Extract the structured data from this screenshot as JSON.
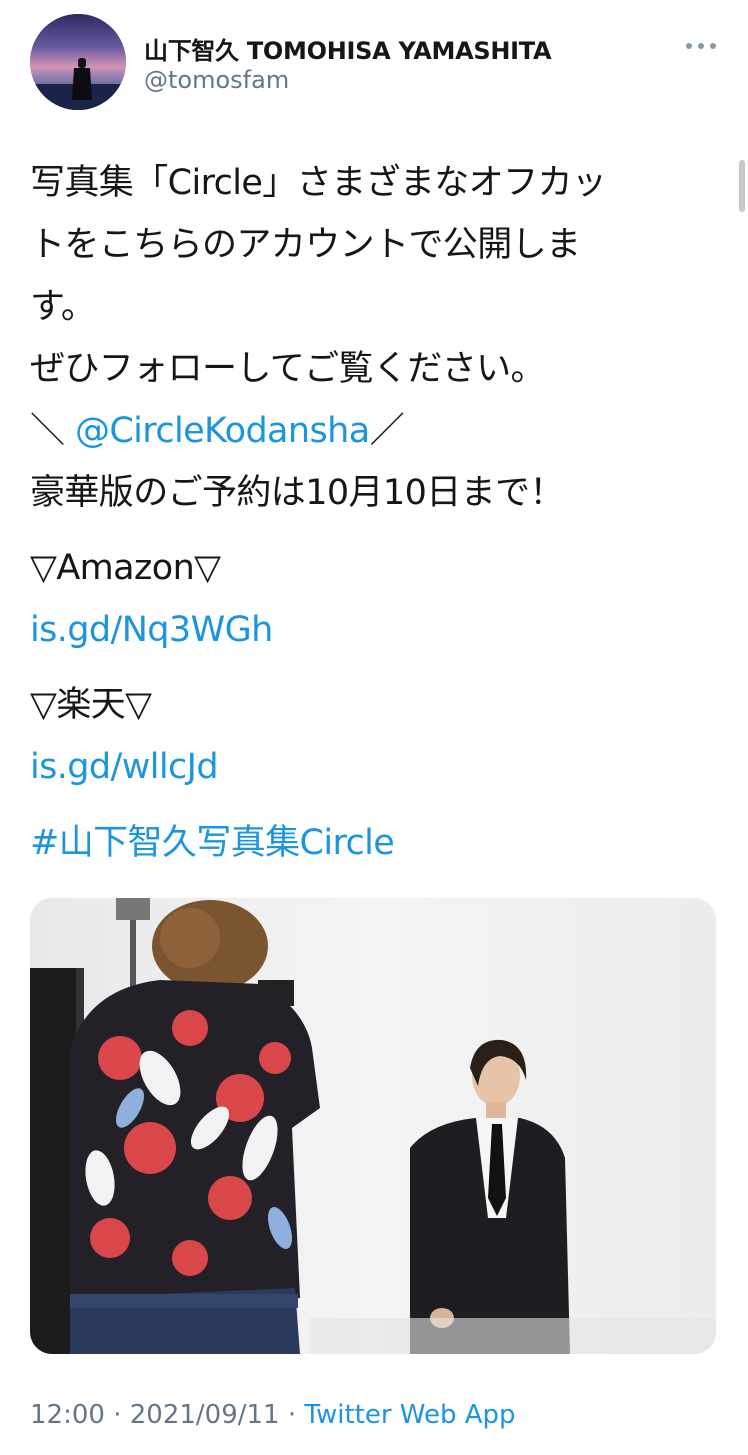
{
  "author": {
    "display_name": "山下智久 TOMOHISA YAMASHITA",
    "handle": "@tomosfam"
  },
  "tweet": {
    "line1": "写真集「Circle」さまざまなオフカッ",
    "line2": "トをこちらのアカウントで公開しま",
    "line3": "す。",
    "line4": "ぜひフォローしてご覧ください。",
    "line5_prefix": "＼ ",
    "mention": "@CircleKodansha",
    "line5_suffix": "／",
    "line6": "豪華版のご予約は10月10日まで！",
    "amazon_label": "▽Amazon▽",
    "amazon_link": "is.gd/Nq3WGh",
    "rakuten_label": "▽楽天▽",
    "rakuten_link": "is.gd/wllcJd",
    "hashtag": "#山下智久写真集Circle"
  },
  "meta": {
    "time": "12:00",
    "separator1": " · ",
    "date": "2021/09/11",
    "separator2": " · ",
    "source": "Twitter Web App"
  },
  "colors": {
    "link": "#1b95e0",
    "secondary_text": "#657786",
    "primary_text": "#14171a"
  },
  "icons": {
    "more": "more-horizontal-icon"
  }
}
